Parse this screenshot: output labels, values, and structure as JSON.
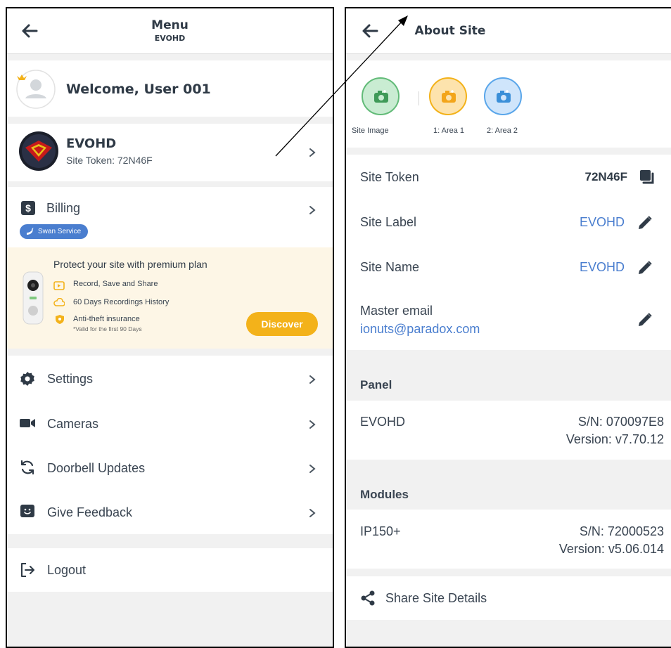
{
  "left": {
    "header": {
      "title": "Menu",
      "subtitle": "EVOHD"
    },
    "welcome": "Welcome, User 001",
    "site": {
      "name": "EVOHD",
      "token_line": "Site Token: 72N46F"
    },
    "billing": {
      "label": "Billing",
      "badge": "Swan Service"
    },
    "promo": {
      "title": "Protect your site with premium plan",
      "features": [
        "Record, Save and Share",
        "60 Days Recordings History",
        "Anti-theft insurance"
      ],
      "note": "*Valid for the first 90 Days",
      "cta": "Discover"
    },
    "menu": [
      "Settings",
      "Cameras",
      "Doorbell Updates",
      "Give Feedback"
    ],
    "logout": "Logout"
  },
  "right": {
    "header": {
      "title": "About Site"
    },
    "images": [
      "Site Image",
      "1: Area 1",
      "2: Area 2"
    ],
    "fields": {
      "token_label": "Site Token",
      "token_value": "72N46F",
      "label_label": "Site Label",
      "label_value": "EVOHD",
      "name_label": "Site Name",
      "name_value": "EVOHD",
      "email_label": "Master email",
      "email_value": "ionuts@paradox.com"
    },
    "panel": {
      "title": "Panel",
      "name": "EVOHD",
      "sn": "S/N: 070097E8",
      "version": "Version: v7.70.12"
    },
    "modules": {
      "title": "Modules",
      "name": "IP150+",
      "sn": "S/N: 72000523",
      "version": "Version: v5.06.014"
    },
    "share": "Share Site Details"
  },
  "colors": {
    "accent_blue": "#4a7ecf",
    "cta_orange": "#f3b21a",
    "promo_bg": "#fdf6e6",
    "text_dark": "#2f3a46"
  }
}
